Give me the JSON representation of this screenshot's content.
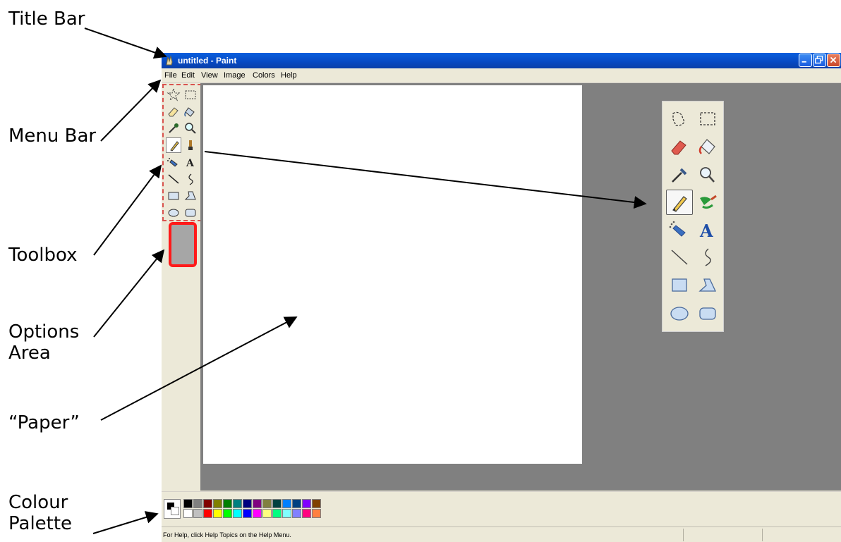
{
  "annotations": {
    "title_bar": "Title Bar",
    "menu_bar": "Menu Bar",
    "toolbox": "Toolbox",
    "options_line1": "Options",
    "options_line2": "Area",
    "paper": "“Paper”",
    "palette_line1": "Colour",
    "palette_line2": "Palette"
  },
  "window": {
    "title": "untitled - Paint",
    "menus": [
      "File",
      "Edit",
      "View",
      "Image",
      "Colors",
      "Help"
    ],
    "status_text": "For Help, click Help Topics on the Help Menu."
  },
  "tools": [
    {
      "name": "free-form-select",
      "icon": "star-select-icon"
    },
    {
      "name": "select",
      "icon": "rect-select-icon"
    },
    {
      "name": "eraser",
      "icon": "eraser-icon"
    },
    {
      "name": "fill-with-color",
      "icon": "bucket-icon"
    },
    {
      "name": "pick-color",
      "icon": "eyedropper-icon"
    },
    {
      "name": "magnifier",
      "icon": "magnifier-icon"
    },
    {
      "name": "pencil",
      "icon": "pencil-icon",
      "active": true
    },
    {
      "name": "brush",
      "icon": "brush-icon"
    },
    {
      "name": "airbrush",
      "icon": "airbrush-icon"
    },
    {
      "name": "text",
      "icon": "text-icon"
    },
    {
      "name": "line",
      "icon": "line-icon"
    },
    {
      "name": "curve",
      "icon": "curve-icon"
    },
    {
      "name": "rectangle",
      "icon": "rectangle-icon"
    },
    {
      "name": "polygon",
      "icon": "polygon-icon"
    },
    {
      "name": "ellipse",
      "icon": "ellipse-icon"
    },
    {
      "name": "rounded-rectangle",
      "icon": "rounded-rect-icon"
    }
  ],
  "palette": {
    "foreground": "#000000",
    "background": "#ffffff",
    "row1": [
      "#000000",
      "#808080",
      "#800000",
      "#808000",
      "#008000",
      "#008080",
      "#000080",
      "#800080",
      "#808040",
      "#004040",
      "#0080ff",
      "#004080",
      "#8000ff",
      "#804000"
    ],
    "row2": [
      "#ffffff",
      "#c0c0c0",
      "#ff0000",
      "#ffff00",
      "#00ff00",
      "#00ffff",
      "#0000ff",
      "#ff00ff",
      "#ffff80",
      "#00ff80",
      "#80ffff",
      "#8080ff",
      "#ff0080",
      "#ff8040"
    ]
  },
  "colors": {
    "options_border": "#ff1a1a",
    "toolbox_dash": "#d9534f",
    "titlebar": "#0a5fde",
    "workspace": "#808080"
  }
}
